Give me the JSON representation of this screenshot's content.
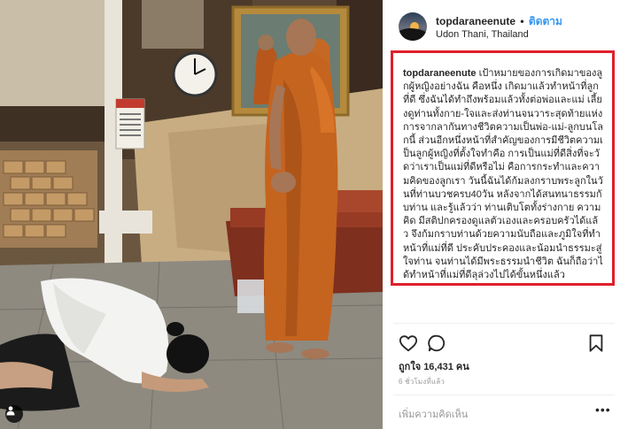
{
  "post": {
    "username": "topdaraneenute",
    "separator": "•",
    "follow_label": "ติดตาม",
    "location": "Udon Thani, Thailand",
    "caption_user": "topdaraneenute",
    "caption_text": "เป้าหมายของการเกิดมาของลูกผู้หญิงอย่างฉัน คือหนึ่ง เกิดมาแล้วทำหน้าที่ลูกที่ดี ซึ่งฉันได้ทำถึงพร้อมแล้วทั้งต่อพ่อและแม่ เลี้ยงดูท่านทั้งกาย-ใจและส่งท่านจนวาระสุดท้ายแห่งการจากลากันทางชีวิตความเป็นพ่อ-แม่-ลูกบนโลกนี้ ส่วนอีกหนึ่งหน้าที่สำคัญของการมีชีวิตความเป็นลูกผู้หญิงที่ตั้งใจทำคือ การเป็นแม่ที่ดีสิ่งที่จะวัดว่าเราเป็นแม่ที่ดีหรือไม่ คือการกระทำและความคิดของลูกเรา วันนี้ฉันได้ก้มลงกราบพระลูกในวันที่ท่านบวชครบ40วัน หลังจากได้สนทนาธรรมกับท่าน และรู้แล้วว่า ท่านเติบโตทั้งร่างกาย ความคิด มีสติปกครองดูแลตัวเองและครอบครัวได้แล้ว จึงก้มกราบท่านด้วยความนับถือและภูมิใจที่ทำหน้าที่แม่ที่ดี ประคับประคองและน้อมนำธรรมะสู่ใจท่าน จนท่านได้มีพระธรรมนำชีวิต ฉันก็ถือว่าได้ทำหน้าที่แม่ที่ดีลุล่วงไปได้ขั้นหนึ่งแล้ว",
    "likes_text": "ถูกใจ 16,431 คน",
    "time_text": "6 ชั่วโมงที่แล้ว",
    "comment_placeholder": "เพิ่มความคิดเห็น",
    "more_label": "•••"
  },
  "photo": {
    "clock_time": "10:10"
  },
  "icons": {
    "like": "heart-icon",
    "comment": "comment-bubble-icon",
    "save": "bookmark-icon",
    "tag": "user-tag-icon"
  },
  "colors": {
    "follow_blue": "#3897f0",
    "highlight_red": "#e0202a",
    "robe_orange": "#c5641f"
  }
}
